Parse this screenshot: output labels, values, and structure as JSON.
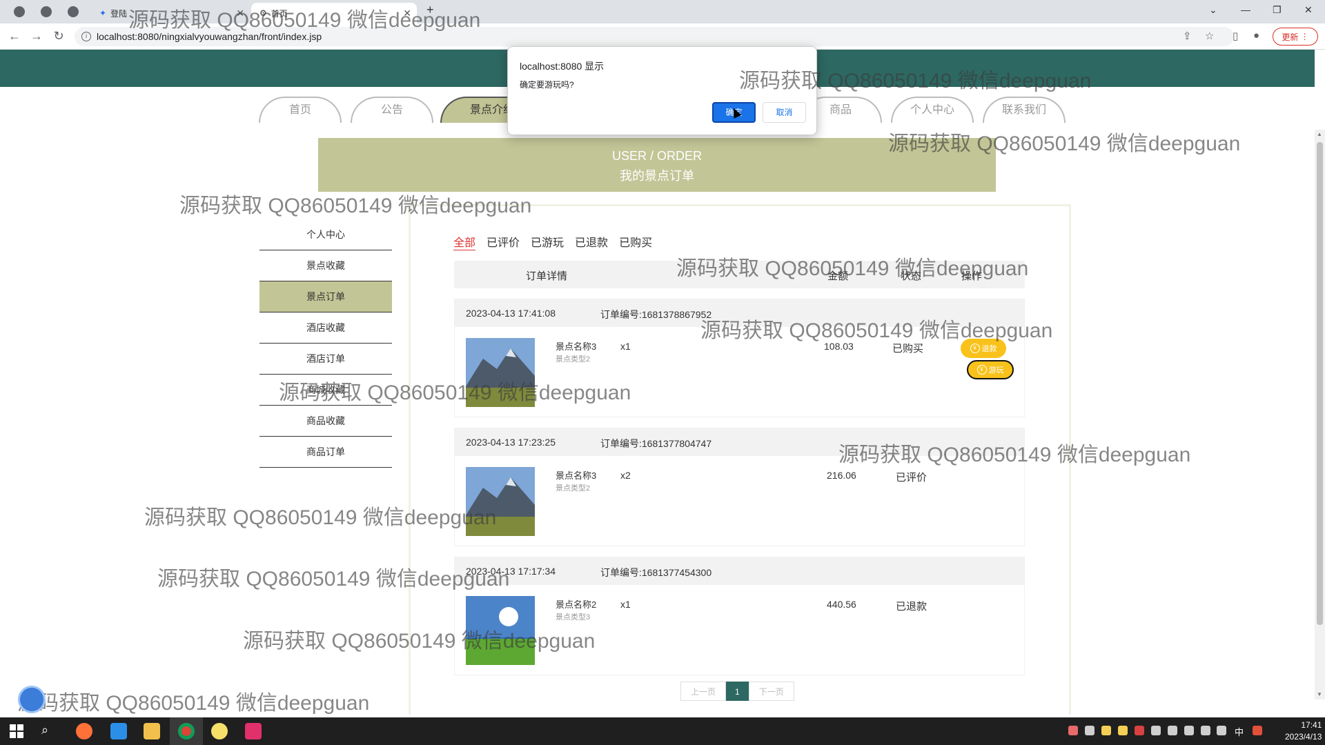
{
  "browser": {
    "tabs": [
      {
        "title": "登陆"
      },
      {
        "title": "首页"
      }
    ],
    "new_tab_symbol": "+",
    "url": "localhost:8080/ningxialvyouwangzhan/front/index.jsp",
    "update_label": "更新"
  },
  "nav": {
    "items": [
      "首页",
      "公告",
      "景点介绍",
      "商品",
      "个人中心",
      "联系我们"
    ],
    "active_index": 2
  },
  "banner": {
    "line1": "USER / ORDER",
    "line2": "我的景点订单"
  },
  "side_menu": {
    "items": [
      "个人中心",
      "景点收藏",
      "景点订单",
      "酒店收藏",
      "酒店订单",
      "商城收藏",
      "商品收藏",
      "商品订单"
    ],
    "active_index": 2
  },
  "filters": {
    "items": [
      "全部",
      "已评价",
      "已游玩",
      "已退款",
      "已购买"
    ],
    "active_index": 0
  },
  "table_header": {
    "detail": "订单详情",
    "amount": "金额",
    "status": "状态",
    "action": "操作"
  },
  "orders": [
    {
      "time": "2023-04-13 17:41:08",
      "order_no": "订单编号:1681378867952",
      "name": "景点名称3",
      "type": "景点类型2",
      "qty": "x1",
      "amount": "108.03",
      "status": "已购买",
      "actions": [
        "退款",
        "游玩"
      ]
    },
    {
      "time": "2023-04-13 17:23:25",
      "order_no": "订单编号:1681377804747",
      "name": "景点名称3",
      "type": "景点类型2",
      "qty": "x2",
      "amount": "216.06",
      "status": "已评价",
      "actions": []
    },
    {
      "time": "2023-04-13 17:17:34",
      "order_no": "订单编号:1681377454300",
      "name": "景点名称2",
      "type": "景点类型3",
      "qty": "x1",
      "amount": "440.56",
      "status": "已退款",
      "actions": []
    }
  ],
  "pager": {
    "prev": "上一页",
    "current": "1",
    "next": "下一页"
  },
  "dialog": {
    "title": "localhost:8080 显示",
    "message": "确定要游玩吗?",
    "ok_label": "确定",
    "cancel_label": "取消"
  },
  "watermark_text": "源码获取 QQ86050149 微信deepguan",
  "taskbar": {
    "ime": "中",
    "time": "17:41",
    "date": "2023/4/13"
  },
  "colors": {
    "header_teal": "#2d6862",
    "olive_accent": "#c2c596",
    "action_yellow": "#f9c21b",
    "filter_active_red": "#dd3333",
    "dialog_blue": "#1a73e8"
  },
  "icons": [
    "back-icon",
    "forward-icon",
    "reload-icon",
    "info-icon",
    "share-icon",
    "star-icon",
    "sidebar-icon",
    "profile-icon",
    "menu-icon",
    "coin-icon",
    "windows-start-icon",
    "search-icon"
  ]
}
